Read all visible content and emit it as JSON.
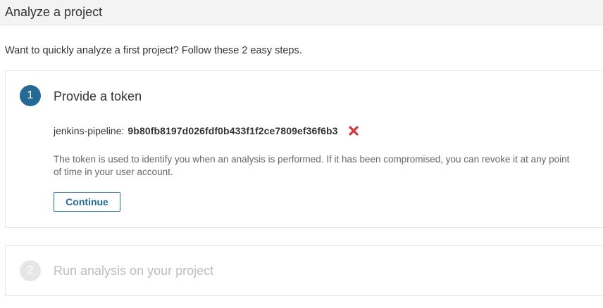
{
  "header": {
    "title": "Analyze a project"
  },
  "intro": {
    "text": "Want to quickly analyze a first project? Follow these 2 easy steps."
  },
  "steps": [
    {
      "number": "1",
      "title": "Provide a token",
      "token_name": "jenkins-pipeline:",
      "token_value": "9b80fb8197d026fdf0b433f1f2ce7809ef36f6b3",
      "help_text": "The token is used to identify you when an analysis is performed. If it has been compromised, you can revoke it at any point of time in your user account.",
      "continue_label": "Continue",
      "revoke_icon": "close-icon"
    },
    {
      "number": "2",
      "title": "Run analysis on your project"
    }
  ],
  "colors": {
    "accent": "#236a97",
    "revoke": "#d4333f",
    "disabled": "#bdbdbd"
  }
}
